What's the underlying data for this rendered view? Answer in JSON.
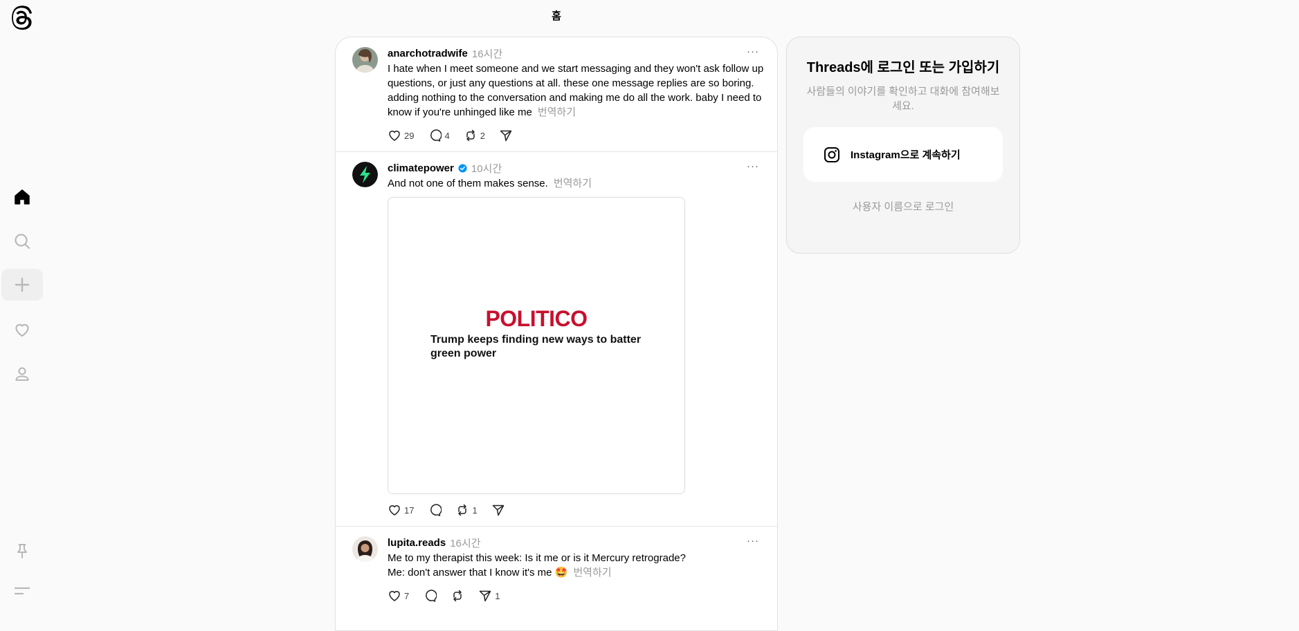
{
  "app": {
    "logo": "threads-logo",
    "page_title": "홈"
  },
  "nav": {
    "items": [
      {
        "name": "home",
        "icon": "home-icon",
        "active": true
      },
      {
        "name": "search",
        "icon": "search-icon"
      },
      {
        "name": "create",
        "icon": "plus-icon"
      },
      {
        "name": "activity",
        "icon": "heart-icon"
      },
      {
        "name": "profile",
        "icon": "user-icon"
      },
      {
        "name": "pinned",
        "icon": "pin-icon"
      },
      {
        "name": "menu",
        "icon": "menu-icon"
      }
    ]
  },
  "posts": [
    {
      "username": "anarchotradwife",
      "time": "16시간",
      "text": "I hate when I meet someone and we start messaging and they won't ask follow up questions, or just any questions at all. these one message replies are so boring. adding nothing to the conversation and making me do all the work. baby I need to know if you're unhinged like me",
      "translate": "번역하기",
      "likes": "29",
      "replies": "4",
      "reposts": "2"
    },
    {
      "username": "climatepower",
      "verified": true,
      "time": "10시간",
      "text": "And not one of them makes sense.",
      "translate": "번역하기",
      "media": {
        "brand": "POLITICO",
        "headline": "Trump keeps finding new ways to batter green power"
      },
      "likes": "17",
      "reposts": "1"
    },
    {
      "username": "lupita.reads",
      "time": "16시간",
      "text_line1": "Me to my therapist this week: Is it me or is it Mercury retrograde?",
      "text_line2": "Me: don't answer that I know it's me 🤩",
      "translate": "번역하기",
      "likes": "7",
      "shares": "1"
    }
  ],
  "login": {
    "title": "Threads에 로그인 또는 가입하기",
    "subtitle": "사람들의 이야기를 확인하고 대화에 참여해보세요.",
    "instagram_button": "Instagram으로 계속하기",
    "username_login": "사용자 이름으로 로그인"
  },
  "colors": {
    "politico_red": "#c8102e",
    "verified_blue": "#0095f6",
    "muted": "#999999"
  }
}
